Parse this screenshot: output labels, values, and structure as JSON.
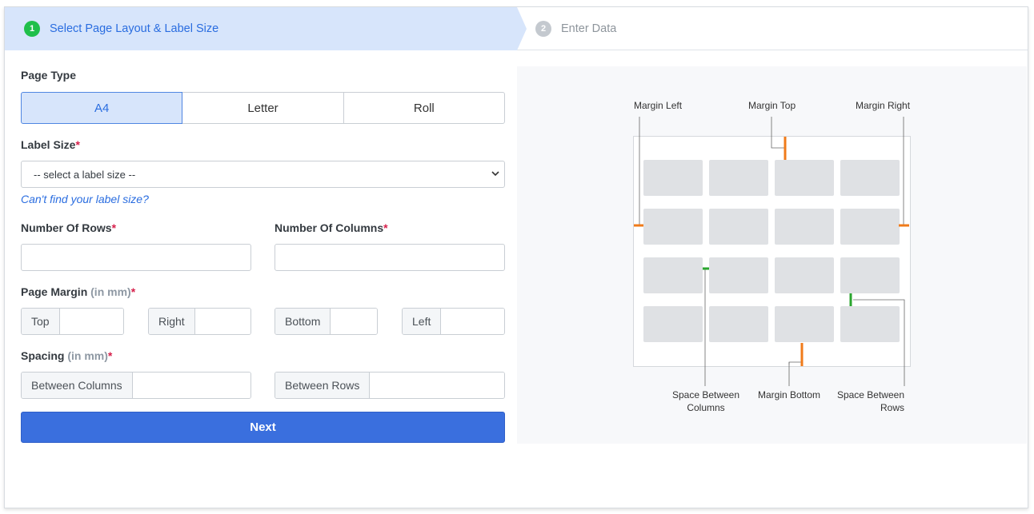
{
  "wizard": {
    "steps": [
      {
        "number": "1",
        "label": "Select Page Layout & Label Size"
      },
      {
        "number": "2",
        "label": "Enter Data"
      }
    ]
  },
  "form": {
    "page_type": {
      "label": "Page Type",
      "options": [
        "A4",
        "Letter",
        "Roll"
      ],
      "selected": "A4"
    },
    "label_size": {
      "label": "Label Size",
      "required_mark": "*",
      "value": "-- select a label size --",
      "help_link": "Can't find your label size?"
    },
    "rows": {
      "label": "Number Of Rows",
      "required_mark": "*",
      "value": ""
    },
    "columns": {
      "label": "Number Of Columns",
      "required_mark": "*",
      "value": ""
    },
    "page_margin": {
      "label": "Page Margin",
      "unit": "(in mm)",
      "required_mark": "*",
      "fields": [
        "Top",
        "Right",
        "Bottom",
        "Left"
      ]
    },
    "spacing": {
      "label": "Spacing",
      "unit": "(in mm)",
      "required_mark": "*",
      "fields": [
        "Between Columns",
        "Between Rows"
      ]
    },
    "next_label": "Next"
  },
  "diagram": {
    "labels": {
      "margin_left": "Margin Left",
      "margin_top": "Margin Top",
      "margin_right": "Margin Right",
      "space_between_columns_1": "Space Between",
      "space_between_columns_2": "Columns",
      "margin_bottom": "Margin Bottom",
      "space_between_rows_1": "Space Between",
      "space_between_rows_2": "Rows"
    },
    "grid": {
      "rows": 4,
      "columns": 4
    },
    "colors": {
      "margin": "#f07b1a",
      "spacing": "#2aa52e",
      "label_cell": "#dfe1e4"
    }
  }
}
